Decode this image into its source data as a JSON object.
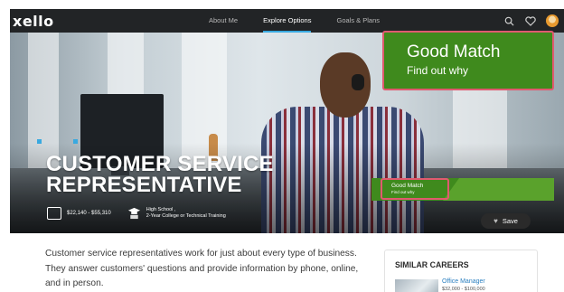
{
  "app": {
    "logo": "xello"
  },
  "nav": {
    "links": [
      {
        "label": "About Me",
        "active": false
      },
      {
        "label": "Explore Options",
        "active": true
      },
      {
        "label": "Goals & Plans",
        "active": false
      }
    ],
    "icons": [
      "search-icon",
      "heart-icon",
      "avatar"
    ]
  },
  "hero": {
    "title_line1": "CUSTOMER SERVICE",
    "title_line2": "REPRESENTATIVE",
    "salary": "$22,140 - $55,310",
    "education_line1": "High School ,",
    "education_line2": "2-Year College or Technical Training"
  },
  "match_big": {
    "title": "Good Match",
    "subtitle": "Find out why"
  },
  "match_small": {
    "title": "Good Match",
    "subtitle": "Find out why"
  },
  "save": {
    "label": "Save"
  },
  "description": "Customer service representatives work for just about every type of business. They answer customers' questions and provide information by phone, online, and in person.",
  "similar_careers": {
    "heading": "SIMILAR CAREERS",
    "items": [
      {
        "name": "Office Manager",
        "salary": "$32,000 - $100,000"
      }
    ]
  },
  "colors": {
    "nav_bg": "#222426",
    "accent_blue": "#39a9e0",
    "match_green": "#3f8a1d",
    "highlight_border": "#e05a6f"
  }
}
